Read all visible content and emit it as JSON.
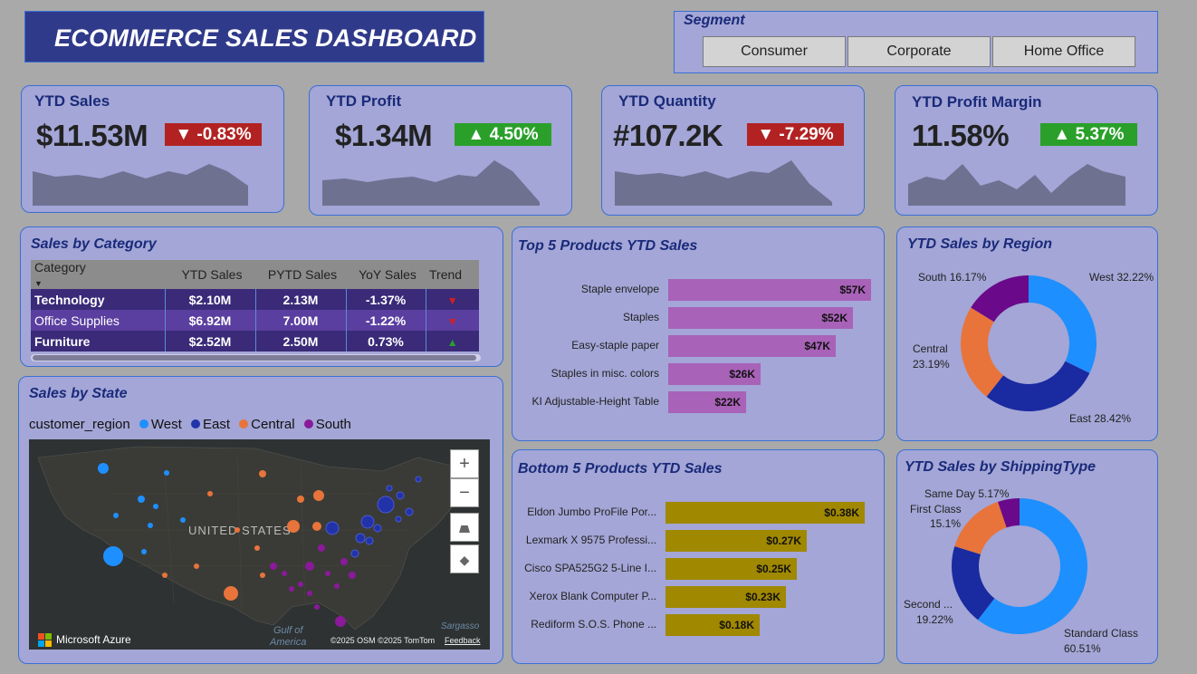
{
  "title": "ECOMMERCE SALES DASHBOARD",
  "segment": {
    "title": "Segment",
    "options": [
      "Consumer",
      "Corporate",
      "Home Office"
    ]
  },
  "kpis": [
    {
      "title": "YTD Sales",
      "value": "$11.53M",
      "change": "▼ -0.83%",
      "direction": "down"
    },
    {
      "title": "YTD Profit",
      "value": "$1.34M",
      "change": "▲ 4.50%",
      "direction": "up"
    },
    {
      "title": "YTD Quantity",
      "value": "#107.2K",
      "change": "▼ -7.29%",
      "direction": "down"
    },
    {
      "title": "YTD Profit Margin",
      "value": "11.58%",
      "change": "▲ 5.37%",
      "direction": "up"
    }
  ],
  "category": {
    "title": "Sales by Category",
    "headers": [
      "Category",
      "YTD Sales",
      "PYTD Sales",
      "YoY Sales",
      "Trend"
    ],
    "rows": [
      {
        "name": "Technology",
        "ytd": "$2.10M",
        "pytd": "2.13M",
        "yoy": "-1.37%",
        "trend": "down"
      },
      {
        "name": "Office Supplies",
        "ytd": "$6.92M",
        "pytd": "7.00M",
        "yoy": "-1.22%",
        "trend": "down"
      },
      {
        "name": "Furniture",
        "ytd": "$2.52M",
        "pytd": "2.50M",
        "yoy": "0.73%",
        "trend": "up"
      }
    ]
  },
  "state_map": {
    "title": "Sales by State",
    "legend_title": "customer_region",
    "legend": [
      {
        "name": "West",
        "color": "#1e8fff"
      },
      {
        "name": "East",
        "color": "#2233aa"
      },
      {
        "name": "Central",
        "color": "#e8743b"
      },
      {
        "name": "South",
        "color": "#8a1a9a"
      }
    ],
    "country_label": "UNITED STATES",
    "gulf_label_1": "Gulf of",
    "gulf_label_2": "America",
    "sea_label": "Sargasso",
    "brand": "Microsoft Azure",
    "copyright": "©2025 OSM  ©2025 TomTom",
    "feedback": "Feedback",
    "zoom_in": "+",
    "zoom_out": "−"
  },
  "top5": {
    "title": "Top 5 Products YTD Sales",
    "color": "#a862b8",
    "items": [
      {
        "name": "Staple envelope",
        "label": "$57K",
        "value": 57
      },
      {
        "name": "Staples",
        "label": "$52K",
        "value": 52
      },
      {
        "name": "Easy-staple paper",
        "label": "$47K",
        "value": 47
      },
      {
        "name": "Staples in misc. colors",
        "label": "$26K",
        "value": 26
      },
      {
        "name": "KI Adjustable-Height Table",
        "label": "$22K",
        "value": 22
      }
    ]
  },
  "bottom5": {
    "title": "Bottom 5 Products YTD Sales",
    "color": "#a08800",
    "items": [
      {
        "name": "Eldon Jumbo ProFile Por...",
        "label": "$0.38K",
        "value": 0.38
      },
      {
        "name": "Lexmark X 9575 Professi...",
        "label": "$0.27K",
        "value": 0.27
      },
      {
        "name": "Cisco SPA525G2 5-Line I...",
        "label": "$0.25K",
        "value": 0.25
      },
      {
        "name": "Xerox Blank Computer P...",
        "label": "$0.23K",
        "value": 0.23
      },
      {
        "name": "Rediform S.O.S. Phone ...",
        "label": "$0.18K",
        "value": 0.18
      }
    ]
  },
  "region": {
    "title": "YTD Sales by Region",
    "slices": [
      {
        "name": "West",
        "label": "West 32.22%",
        "value": 32.22,
        "color": "#1e8fff"
      },
      {
        "name": "East",
        "label": "East 28.42%",
        "value": 28.42,
        "color": "#1a2aa0"
      },
      {
        "name": "Central",
        "label1": "Central",
        "label2": "23.19%",
        "value": 23.19,
        "color": "#e8743b"
      },
      {
        "name": "South",
        "label": "South 16.17%",
        "value": 16.17,
        "color": "#6a0a8a"
      }
    ]
  },
  "shipping": {
    "title": "YTD Sales by ShippingType",
    "slices": [
      {
        "name": "Standard Class",
        "label1": "Standard Class",
        "label2": "60.51%",
        "value": 60.51,
        "color": "#1e8fff"
      },
      {
        "name": "Second Class",
        "label1": "Second ...",
        "label2": "19.22%",
        "value": 19.22,
        "color": "#1a2aa0"
      },
      {
        "name": "First Class",
        "label1": "First Class",
        "label2": "15.1%",
        "value": 15.1,
        "color": "#e8743b"
      },
      {
        "name": "Same Day",
        "label": "Same Day 5.17%",
        "value": 5.17,
        "color": "#6a0a8a"
      }
    ]
  },
  "chart_data": [
    {
      "type": "bar",
      "title": "Top 5 Products YTD Sales",
      "categories": [
        "Staple envelope",
        "Staples",
        "Easy-staple paper",
        "Staples in misc. colors",
        "KI Adjustable-Height Table"
      ],
      "values": [
        57,
        52,
        47,
        26,
        22
      ],
      "unit": "$K"
    },
    {
      "type": "bar",
      "title": "Bottom 5 Products YTD Sales",
      "categories": [
        "Eldon Jumbo ProFile Por...",
        "Lexmark X 9575 Professi...",
        "Cisco SPA525G2 5-Line I...",
        "Xerox Blank Computer P...",
        "Rediform S.O.S. Phone ..."
      ],
      "values": [
        0.38,
        0.27,
        0.25,
        0.23,
        0.18
      ],
      "unit": "$K"
    },
    {
      "type": "pie",
      "title": "YTD Sales by Region",
      "categories": [
        "West",
        "East",
        "Central",
        "South"
      ],
      "values": [
        32.22,
        28.42,
        23.19,
        16.17
      ]
    },
    {
      "type": "pie",
      "title": "YTD Sales by ShippingType",
      "categories": [
        "Standard Class",
        "Second Class",
        "First Class",
        "Same Day"
      ],
      "values": [
        60.51,
        19.22,
        15.1,
        5.17
      ]
    }
  ]
}
